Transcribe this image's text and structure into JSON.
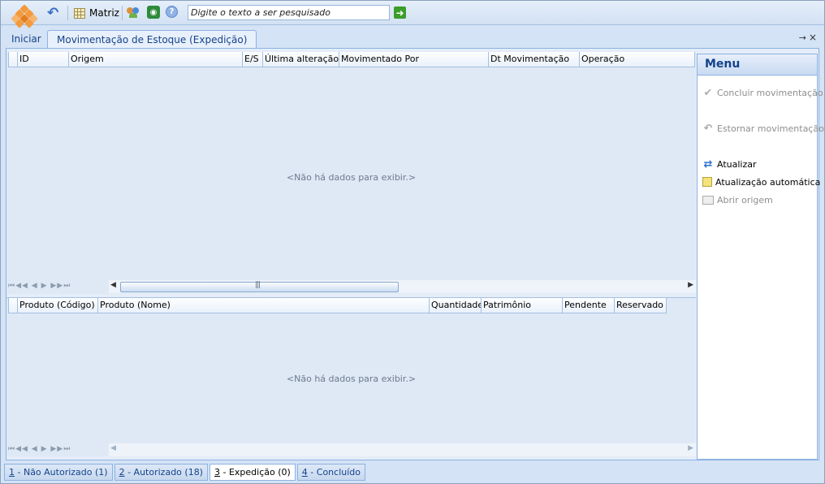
{
  "toolbar": {
    "matriz_label": "Matriz",
    "search_placeholder": "Digite o texto a ser pesquisado"
  },
  "tabs": {
    "home": "Iniciar",
    "active": "Movimentação de Estoque (Expedição)",
    "pin": "→",
    "close": "×"
  },
  "grid1": {
    "columns": [
      "ID",
      "Origem",
      "E/S",
      "Última alteração",
      "Movimentado Por",
      "Dt Movimentação",
      "Operação"
    ],
    "empty_text": "<Não há dados para exibir.>"
  },
  "grid2": {
    "columns": [
      "Produto (Código)",
      "Produto (Nome)",
      "Quantidade",
      "Patrimônio",
      "Pendente",
      "Reservado"
    ],
    "empty_text": "<Não há dados para exibir.>"
  },
  "menu": {
    "title": "Menu",
    "items": [
      {
        "label": "Concluir movimentação",
        "icon": "check-icon",
        "enabled": false
      },
      {
        "label": "Estornar movimentação",
        "icon": "undo-icon",
        "enabled": false
      },
      {
        "label": "Atualizar",
        "icon": "refresh-icon",
        "enabled": true
      },
      {
        "label": "Atualização automática",
        "icon": "auto-refresh-icon",
        "enabled": true
      },
      {
        "label": "Abrir origem",
        "icon": "open-icon",
        "enabled": false
      }
    ]
  },
  "status_tabs": [
    {
      "num": "1",
      "label": " - Não Autorizado (1)"
    },
    {
      "num": "2",
      "label": " - Autorizado (18)"
    },
    {
      "num": "3",
      "label": " - Expedição (0)"
    },
    {
      "num": "4",
      "label": " - Concluído"
    }
  ],
  "active_status_tab": 2,
  "colors": {
    "accent": "#15428b",
    "background": "#d4e3f5",
    "logo": "#f39a3c"
  }
}
